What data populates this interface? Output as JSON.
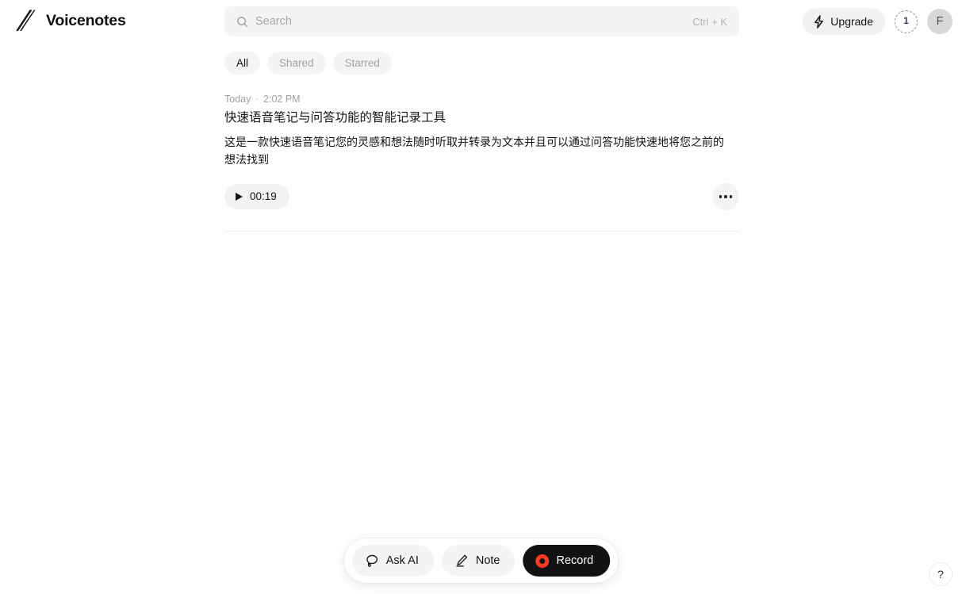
{
  "app": {
    "name": "Voicenotes",
    "logo_icon": "hatched-triangle-logo"
  },
  "search": {
    "placeholder": "Search",
    "value": "",
    "shortcut": "Ctrl + K",
    "icon": "search-icon"
  },
  "top_actions": {
    "upgrade_label": "Upgrade",
    "upgrade_icon": "lightning-bolt-icon",
    "credits_count": "1",
    "avatar_initial": "F"
  },
  "filters": {
    "items": [
      {
        "label": "All",
        "active": true
      },
      {
        "label": "Shared",
        "active": false
      },
      {
        "label": "Starred",
        "active": false
      }
    ]
  },
  "notes": [
    {
      "day": "Today",
      "separator": "·",
      "time": "2:02 PM",
      "title": "快速语音笔记与问答功能的智能记录工具",
      "body": "这是一款快速语音笔记您的灵感和想法随时听取并转录为文本并且可以通过问答功能快速地将您之前的想法找到",
      "duration": "00:19",
      "play_icon": "play-icon",
      "more_icon": "ellipsis-icon"
    }
  ],
  "dock": {
    "ask_ai_label": "Ask AI",
    "ask_ai_icon": "chat-bubble-icon",
    "note_label": "Note",
    "note_icon": "pencil-icon",
    "record_label": "Record",
    "record_icon": "record-dot-icon"
  },
  "help": {
    "label": "?"
  },
  "colors": {
    "accent_record": "#f73c22",
    "chip_bg": "#f4f4f5",
    "text_primary": "#111214",
    "text_muted": "#a0a0a6",
    "record_bg": "#121214"
  }
}
